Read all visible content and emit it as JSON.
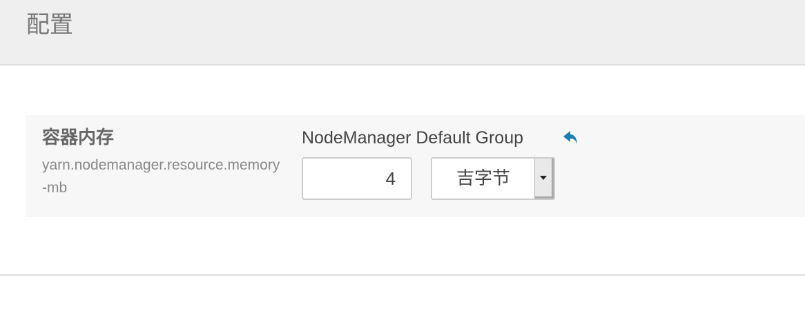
{
  "header": {
    "title": "配置"
  },
  "property": {
    "display_name": "容器内存",
    "key": "yarn.nodemanager.resource.memory-mb",
    "group": "NodeManager Default Group",
    "value": "4",
    "unit": {
      "selected": "吉字节"
    },
    "undo_icon": "undo-arrow-icon"
  },
  "colors": {
    "header_bg": "#f0eff0",
    "panel_bg": "#f7f7f7",
    "accent": "#1a7fb5"
  }
}
